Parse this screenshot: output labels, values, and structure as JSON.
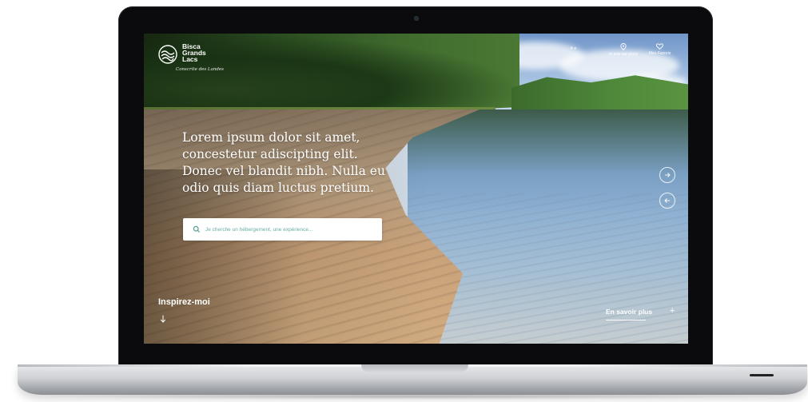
{
  "brand": {
    "name_lines": [
      "Bisca",
      "Grands",
      "Lacs"
    ],
    "tagline": "Conscrite des Landes"
  },
  "nav": {
    "lang": "fr",
    "location_label": "Je suis sur place",
    "favorites_label": "Mes Favoris"
  },
  "hero": {
    "headline": "Lorem ipsum dolor sit amet, concestetur adiscipting elit. Donec vel blandit nibh. Nulla eu odio quis diam luctus pretium."
  },
  "search": {
    "placeholder": "Je cherche un hébergement, une expérience..."
  },
  "bottom": {
    "inspire_label": "Inspirez-moi",
    "more_label": "En savoir plus",
    "more_icon": "+"
  },
  "colors": {
    "search_text": "#5aa398",
    "bezel": "#0b0b0d"
  }
}
